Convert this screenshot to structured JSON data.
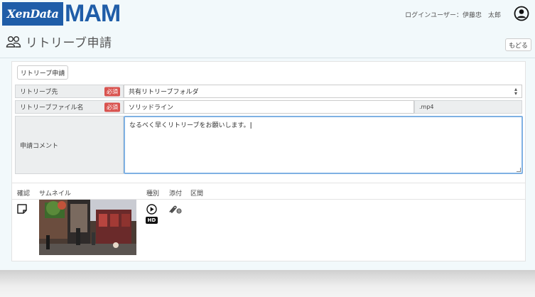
{
  "header": {
    "logo_left": "XenData",
    "logo_right": "MAM",
    "login_user": "ログインユーザー：伊藤忠　太郎"
  },
  "page": {
    "title": "リトリーブ申請",
    "back_label": "もどる"
  },
  "form": {
    "submit_label": "リトリーブ申請",
    "required_label": "必須",
    "destination": {
      "label": "リトリーブ先",
      "value": "共有リトリーブフォルダ"
    },
    "filename": {
      "label": "リトリーブファイル名",
      "value": "ソリッドライン",
      "extension": ".mp4"
    },
    "comment": {
      "label": "申請コメント",
      "value": "なるべく早くリトリーブをお願いします。"
    }
  },
  "files": {
    "columns": {
      "confirm": "確認",
      "thumbnail": "サムネイル",
      "type": "種別",
      "attachment": "添付",
      "section": "区間"
    },
    "rows": [
      {
        "type_badge": "HD",
        "attachment_count": "0"
      }
    ]
  },
  "icons": {
    "page": "users-icon",
    "user": "user-circle-icon",
    "confirm": "note-icon",
    "type": "play-circle-icon",
    "attachment": "paperclip-icon"
  },
  "colors": {
    "brand": "#1f5da8",
    "required": "#d9534f",
    "focus": "#7fb1e3"
  }
}
